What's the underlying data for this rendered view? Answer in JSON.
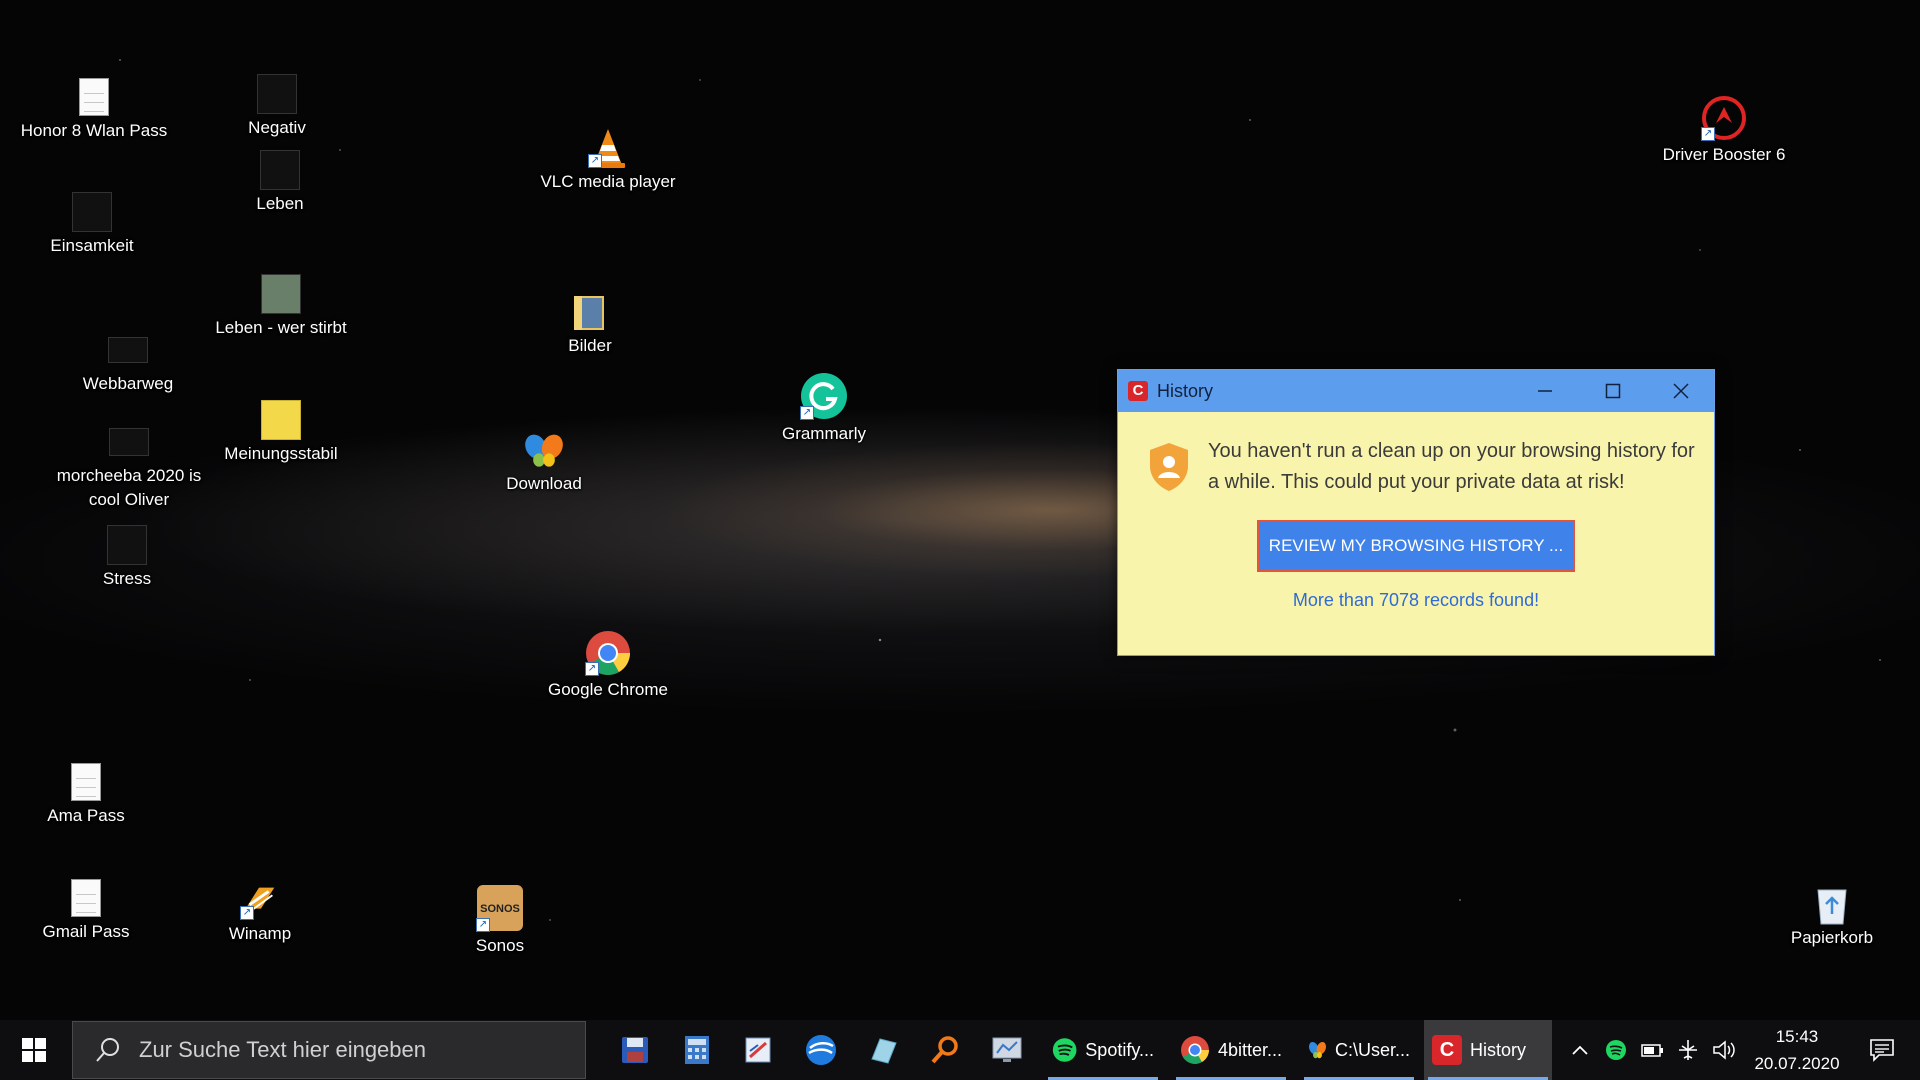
{
  "desktop": {
    "icons": [
      {
        "label": "Honor 8 Wlan Pass"
      },
      {
        "label": "Negativ"
      },
      {
        "label": "Leben"
      },
      {
        "label": "Einsamkeit"
      },
      {
        "label": "Leben - wer stirbt"
      },
      {
        "label": "Webbarweg"
      },
      {
        "label": "Meinungsstabil"
      },
      {
        "label": "morcheeba 2020 is cool Oliver"
      },
      {
        "label": "Stress"
      },
      {
        "label": "VLC media player"
      },
      {
        "label": "Bilder"
      },
      {
        "label": "Download"
      },
      {
        "label": "Grammarly"
      },
      {
        "label": "Google Chrome"
      },
      {
        "label": "Driver Booster 6"
      },
      {
        "label": "Ama Pass"
      },
      {
        "label": "Gmail Pass"
      },
      {
        "label": "Winamp"
      },
      {
        "label": "Sonos"
      },
      {
        "label": "Papierkorb"
      }
    ]
  },
  "popup": {
    "app_logo": "C",
    "title": "History",
    "message": "You haven't run a clean up on your browsing history for a while. This could put your private data at risk!",
    "button_label": "REVIEW MY BROWSING HISTORY ...",
    "link_text": "More than 7078 records found!",
    "colors": {
      "titlebar": "#5d9ded",
      "body": "#f9f4ab",
      "button": "#3f82ea",
      "button_border": "#e2553b",
      "link": "#2f6bd8"
    }
  },
  "taskbar": {
    "search_placeholder": "Zur Suche Text hier eingeben",
    "pinned_icons": [
      "save-disk-icon",
      "calculator-icon",
      "drawing-app-icon",
      "swirl-app-icon",
      "glass-app-icon",
      "search-magnifier-icon",
      "monitor-app-icon"
    ],
    "apps": [
      {
        "label": "Spotify...",
        "icon": "spotify-icon"
      },
      {
        "label": "4bitter...",
        "icon": "chrome-icon"
      },
      {
        "label": "C:\\User...",
        "icon": "butterfly-icon"
      },
      {
        "label": "History",
        "icon": "c-logo-icon",
        "active": true
      }
    ],
    "tray_icons": [
      "chevron-up-icon",
      "spotify-tray-icon",
      "battery-icon",
      "airplane-icon",
      "volume-icon"
    ],
    "time": "15:43",
    "date": "20.07.2020"
  }
}
